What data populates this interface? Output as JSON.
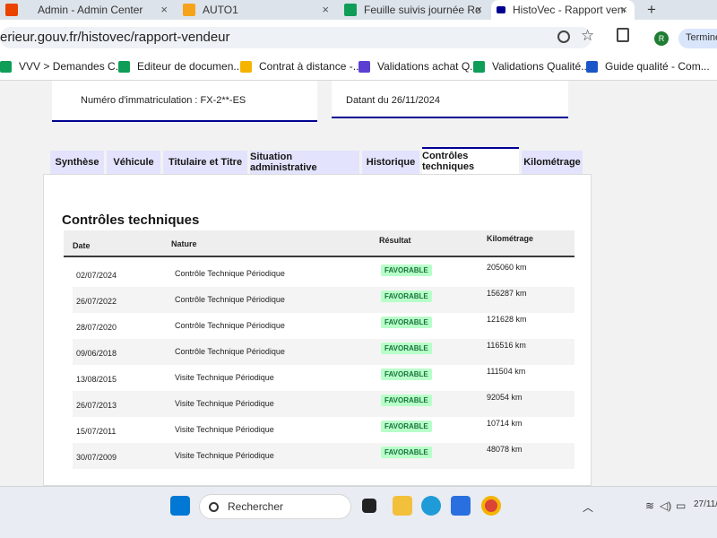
{
  "browser": {
    "tabs": [
      {
        "label": "Admin - Admin Center",
        "close": "×",
        "color": "#ea4300"
      },
      {
        "label": "AUTO1",
        "close": "×",
        "color": "#f7a21b"
      },
      {
        "label": "Feuille suivis journée Ron",
        "close": "×",
        "color": "#0f9d58"
      },
      {
        "label": "HistoVec - Rapport vend",
        "close": "×",
        "color": "#000091"
      }
    ],
    "new_tab": "+",
    "url": "erieur.gouv.fr/histovec/rapport-vendeur",
    "profile_initial": "R",
    "terminer": "Terminer",
    "bookmarks": [
      {
        "label": "VVV > Demandes C...",
        "color": "#0f9d58"
      },
      {
        "label": "Editeur de documen...",
        "color": "#0f9d58"
      },
      {
        "label": "Contrat à distance -...",
        "color": "#f4b400"
      },
      {
        "label": "Validations achat Q...",
        "color": "#5b3fd1"
      },
      {
        "label": "Validations Qualité...",
        "color": "#0f9d58"
      },
      {
        "label": "Guide qualité - Com...",
        "color": "#1a56c7"
      }
    ]
  },
  "report": {
    "cards": [
      {
        "label": "Numéro d'immatriculation : FX-2**-ES"
      },
      {
        "label": "Datant du 26/11/2024"
      }
    ],
    "tabs": [
      "Synthèse",
      "Véhicule",
      "Titulaire et Titre",
      "Situation administrative",
      "Historique",
      "Contrôles techniques",
      "Kilométrage"
    ],
    "active_tab": "Contrôles techniques",
    "section_title": "Contrôles techniques",
    "table": {
      "headers": [
        "Date",
        "Nature",
        "Résultat",
        "Kilométrage"
      ],
      "rows": [
        {
          "date": "02/07/2024",
          "nature": "Contrôle Technique Périodique",
          "result": "FAVORABLE",
          "km": "205060 km"
        },
        {
          "date": "26/07/2022",
          "nature": "Contrôle Technique Périodique",
          "result": "FAVORABLE",
          "km": "156287 km"
        },
        {
          "date": "28/07/2020",
          "nature": "Contrôle Technique Périodique",
          "result": "FAVORABLE",
          "km": "121628 km"
        },
        {
          "date": "09/06/2018",
          "nature": "Contrôle Technique Périodique",
          "result": "FAVORABLE",
          "km": "116516 km"
        },
        {
          "date": "13/08/2015",
          "nature": "Visite Technique Périodique",
          "result": "FAVORABLE",
          "km": "111504 km"
        },
        {
          "date": "26/07/2013",
          "nature": "Visite Technique Périodique",
          "result": "FAVORABLE",
          "km": "92054 km"
        },
        {
          "date": "15/07/2011",
          "nature": "Visite Technique Périodique",
          "result": "FAVORABLE",
          "km": "10714 km"
        },
        {
          "date": "30/07/2009",
          "nature": "Visite Technique Périodique",
          "result": "FAVORABLE",
          "km": "48078 km"
        }
      ]
    }
  },
  "taskbar": {
    "search_placeholder": "Rechercher",
    "clock": "27/11/"
  },
  "colors": {
    "accent": "#000091",
    "favorable_bg": "#b8fec9",
    "favorable_fg": "#18753c"
  }
}
